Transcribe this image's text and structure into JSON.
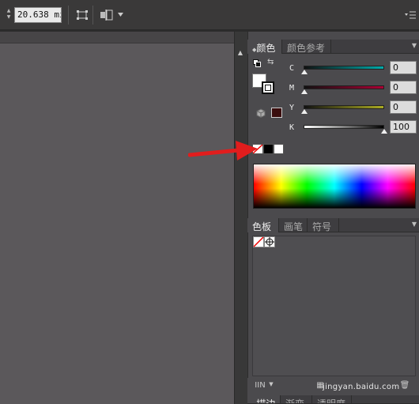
{
  "toolbar": {
    "stroke_value": "20.638 mi",
    "icons": [
      "spinner-arrows-icon",
      "transform-bounds-icon",
      "align-objects-icon",
      "dropdown-caret-icon",
      "panel-menu-icon"
    ]
  },
  "panel_color": {
    "tabs": [
      {
        "label": "颜色",
        "active": true
      },
      {
        "label": "颜色参考",
        "active": false
      }
    ],
    "channels": [
      {
        "label": "C",
        "value": "0",
        "level": 0,
        "color": "#0ff"
      },
      {
        "label": "M",
        "value": "0",
        "level": 0,
        "color": "#f0f"
      },
      {
        "label": "Y",
        "value": "0",
        "level": 0,
        "color": "#ff0"
      },
      {
        "label": "K",
        "value": "100",
        "level": 1,
        "color": "#000"
      }
    ],
    "icons": [
      "default-fill-stroke-icon",
      "swap-fill-stroke-icon",
      "fill-swatch-icon",
      "stroke-swatch-icon",
      "out-of-gamut-cube-icon",
      "none-swatch-icon",
      "black-swatch-icon",
      "white-swatch-icon"
    ]
  },
  "panel_swatches": {
    "tabs": [
      {
        "label": "色板",
        "active": true
      },
      {
        "label": "画笔",
        "active": false
      },
      {
        "label": "符号",
        "active": false
      }
    ],
    "swatches": [
      "none-swatch",
      "registration-swatch"
    ]
  },
  "panel_stroke": {
    "tabs": [
      {
        "label": "描边",
        "active": true
      },
      {
        "label": "渐变",
        "active": false
      },
      {
        "label": "透明度",
        "active": false
      }
    ]
  },
  "watermark": "jingyan.baidu.com",
  "annotation": {
    "color": "#e11d1d"
  }
}
